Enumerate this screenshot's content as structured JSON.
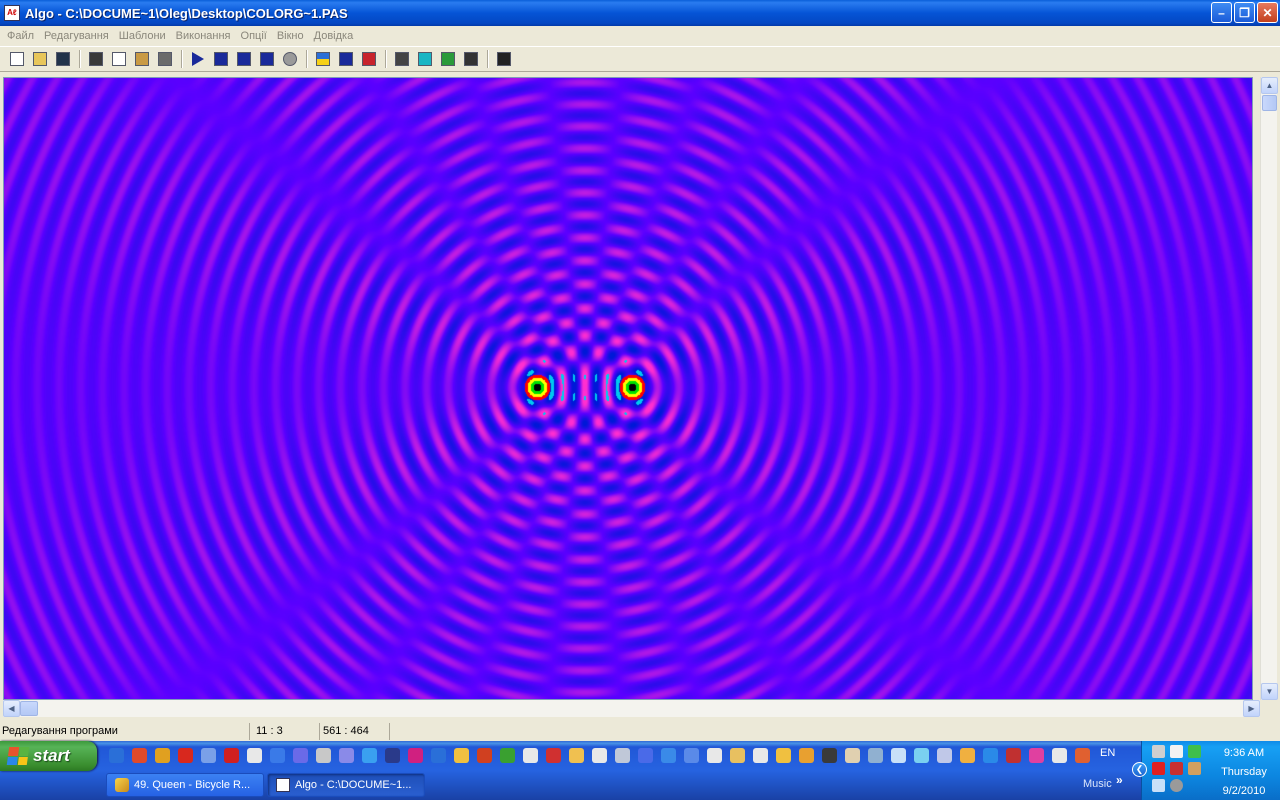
{
  "window": {
    "app_icon_text": "Aℓ",
    "title": "Algo - C:\\DOCUME~1\\Oleg\\Desktop\\COLORG~1.PAS",
    "buttons": [
      "minimize",
      "restore",
      "close"
    ]
  },
  "menu": {
    "items": [
      "Файл",
      "Редагування",
      "Шаблони",
      "Виконання",
      "Опції",
      "Вікно",
      "Довідка"
    ]
  },
  "toolbar": {
    "buttons": [
      {
        "name": "new-file-icon",
        "color": "#ffffff"
      },
      {
        "name": "open-folder-icon",
        "color": "#e8c65a"
      },
      {
        "name": "save-icon",
        "color": "#22334a"
      },
      {
        "name": "sep"
      },
      {
        "name": "cut-icon",
        "color": "#3a3a3a"
      },
      {
        "name": "copy-icon",
        "color": "#ffffff"
      },
      {
        "name": "paste-icon",
        "color": "#c99a44"
      },
      {
        "name": "format-icon",
        "color": "#6b6b6b"
      },
      {
        "name": "sep"
      },
      {
        "name": "run-icon",
        "color": "#1a2a9a"
      },
      {
        "name": "step-over-icon",
        "color": "#1a2a9a"
      },
      {
        "name": "step-into-icon",
        "color": "#1a2a9a"
      },
      {
        "name": "run-to-cursor-icon",
        "color": "#1a2a9a"
      },
      {
        "name": "stop-icon",
        "color": "#9a9a9a"
      },
      {
        "name": "sep"
      },
      {
        "name": "ukrainian-flag-icon",
        "color": "#2b6fd6"
      },
      {
        "name": "english-text-icon",
        "color": "#1a2a9a"
      },
      {
        "name": "uk-flag-icon",
        "color": "#c8232c"
      },
      {
        "name": "sep"
      },
      {
        "name": "list-icon",
        "color": "#444444"
      },
      {
        "name": "window-cyan-icon",
        "color": "#19b6c4"
      },
      {
        "name": "window-green-icon",
        "color": "#2a9a3a"
      },
      {
        "name": "window-dark-icon",
        "color": "#333333"
      },
      {
        "name": "sep"
      },
      {
        "name": "context-help-icon",
        "color": "#222222"
      }
    ]
  },
  "status": {
    "mode": "Редагування програми",
    "cursor": "11 :  3",
    "size": "561 : 464"
  },
  "taskbar": {
    "start_label": "start",
    "tasks": [
      {
        "label": "49. Queen - Bicycle R...",
        "active": false
      },
      {
        "label": "Algo - C:\\DOCUME~1...",
        "active": true
      }
    ],
    "language": "EN",
    "toolbar_label": "Music",
    "clock": {
      "time": "9:36 AM",
      "day": "Thursday",
      "date": "9/2/2010"
    }
  },
  "colors": {
    "title_gradient": "#0554d6",
    "wave_background": "#5a00ff",
    "wave_pink": "#ff2fd0",
    "wave_blue": "#0018d8",
    "wave_cyan": "#00c8f0",
    "wave_green": "#00e000",
    "wave_yellow": "#ffff00",
    "wave_red": "#ff0000",
    "wave_black": "#000000"
  }
}
